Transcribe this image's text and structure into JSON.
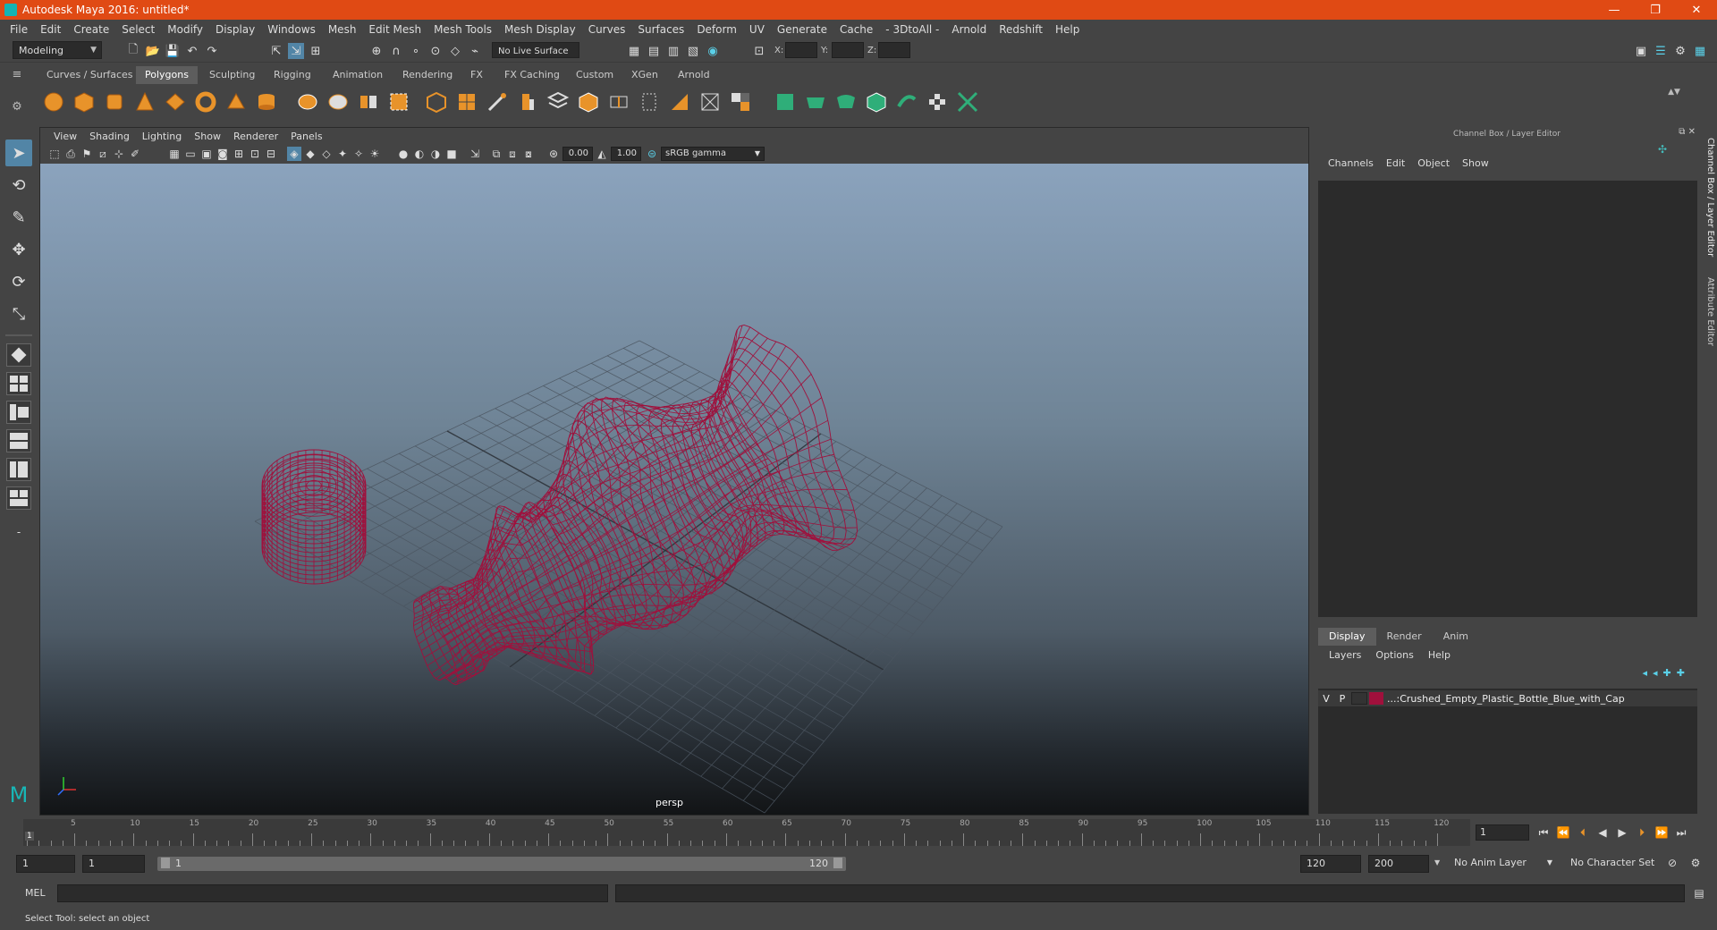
{
  "window": {
    "title": "Autodesk Maya 2016: untitled*",
    "controls": [
      "—",
      "❐",
      "✕"
    ]
  },
  "menubar": [
    "File",
    "Edit",
    "Create",
    "Select",
    "Modify",
    "Display",
    "Windows",
    "Mesh",
    "Edit Mesh",
    "Mesh Tools",
    "Mesh Display",
    "Curves",
    "Surfaces",
    "Deform",
    "UV",
    "Generate",
    "Cache",
    "- 3DtoAll -",
    "Arnold",
    "Redshift",
    "Help"
  ],
  "statusline": {
    "menuset": "Modeling",
    "live_surface": "No Live Surface",
    "x_label": "X:",
    "y_label": "Y:",
    "z_label": "Z:"
  },
  "shelf": {
    "tabs": [
      "Curves / Surfaces",
      "Polygons",
      "Sculpting",
      "Rigging",
      "Animation",
      "Rendering",
      "FX",
      "FX Caching",
      "Custom",
      "XGen",
      "Arnold"
    ],
    "active_tab": "Polygons"
  },
  "viewport": {
    "menus": [
      "View",
      "Shading",
      "Lighting",
      "Show",
      "Renderer",
      "Panels"
    ],
    "exposure": "0.00",
    "gamma": "1.00",
    "color_space": "sRGB gamma",
    "camera_label": "persp",
    "wire_color": "#a0103c"
  },
  "right_panel": {
    "title": "Channel Box / Layer Editor",
    "cb_menus": [
      "Channels",
      "Edit",
      "Object",
      "Show"
    ],
    "layer_tabs": [
      "Display",
      "Render",
      "Anim"
    ],
    "layer_menus": [
      "Layers",
      "Options",
      "Help"
    ],
    "layer": {
      "v": "V",
      "p": "P",
      "name": "...:Crushed_Empty_Plastic_Bottle_Blue_with_Cap",
      "color": "#a0103c"
    },
    "side_tabs": [
      "Channel Box / Layer Editor",
      "Attribute Editor"
    ]
  },
  "timeline": {
    "ticks": [
      "5",
      "10",
      "15",
      "20",
      "25",
      "30",
      "35",
      "40",
      "45",
      "50",
      "55",
      "60",
      "65",
      "70",
      "75",
      "80",
      "85",
      "90",
      "95",
      "100",
      "105",
      "110",
      "115",
      "120"
    ],
    "current_frame_marker": "1",
    "current_frame_field": "1"
  },
  "range": {
    "start": "1",
    "start_inner": "1",
    "bar_start": "1",
    "bar_end": "120",
    "end_inner": "120",
    "end": "200",
    "anim_layer": "No Anim Layer",
    "character_set": "No Character Set"
  },
  "command": {
    "label": "MEL"
  },
  "help_line": "Select Tool: select an object"
}
